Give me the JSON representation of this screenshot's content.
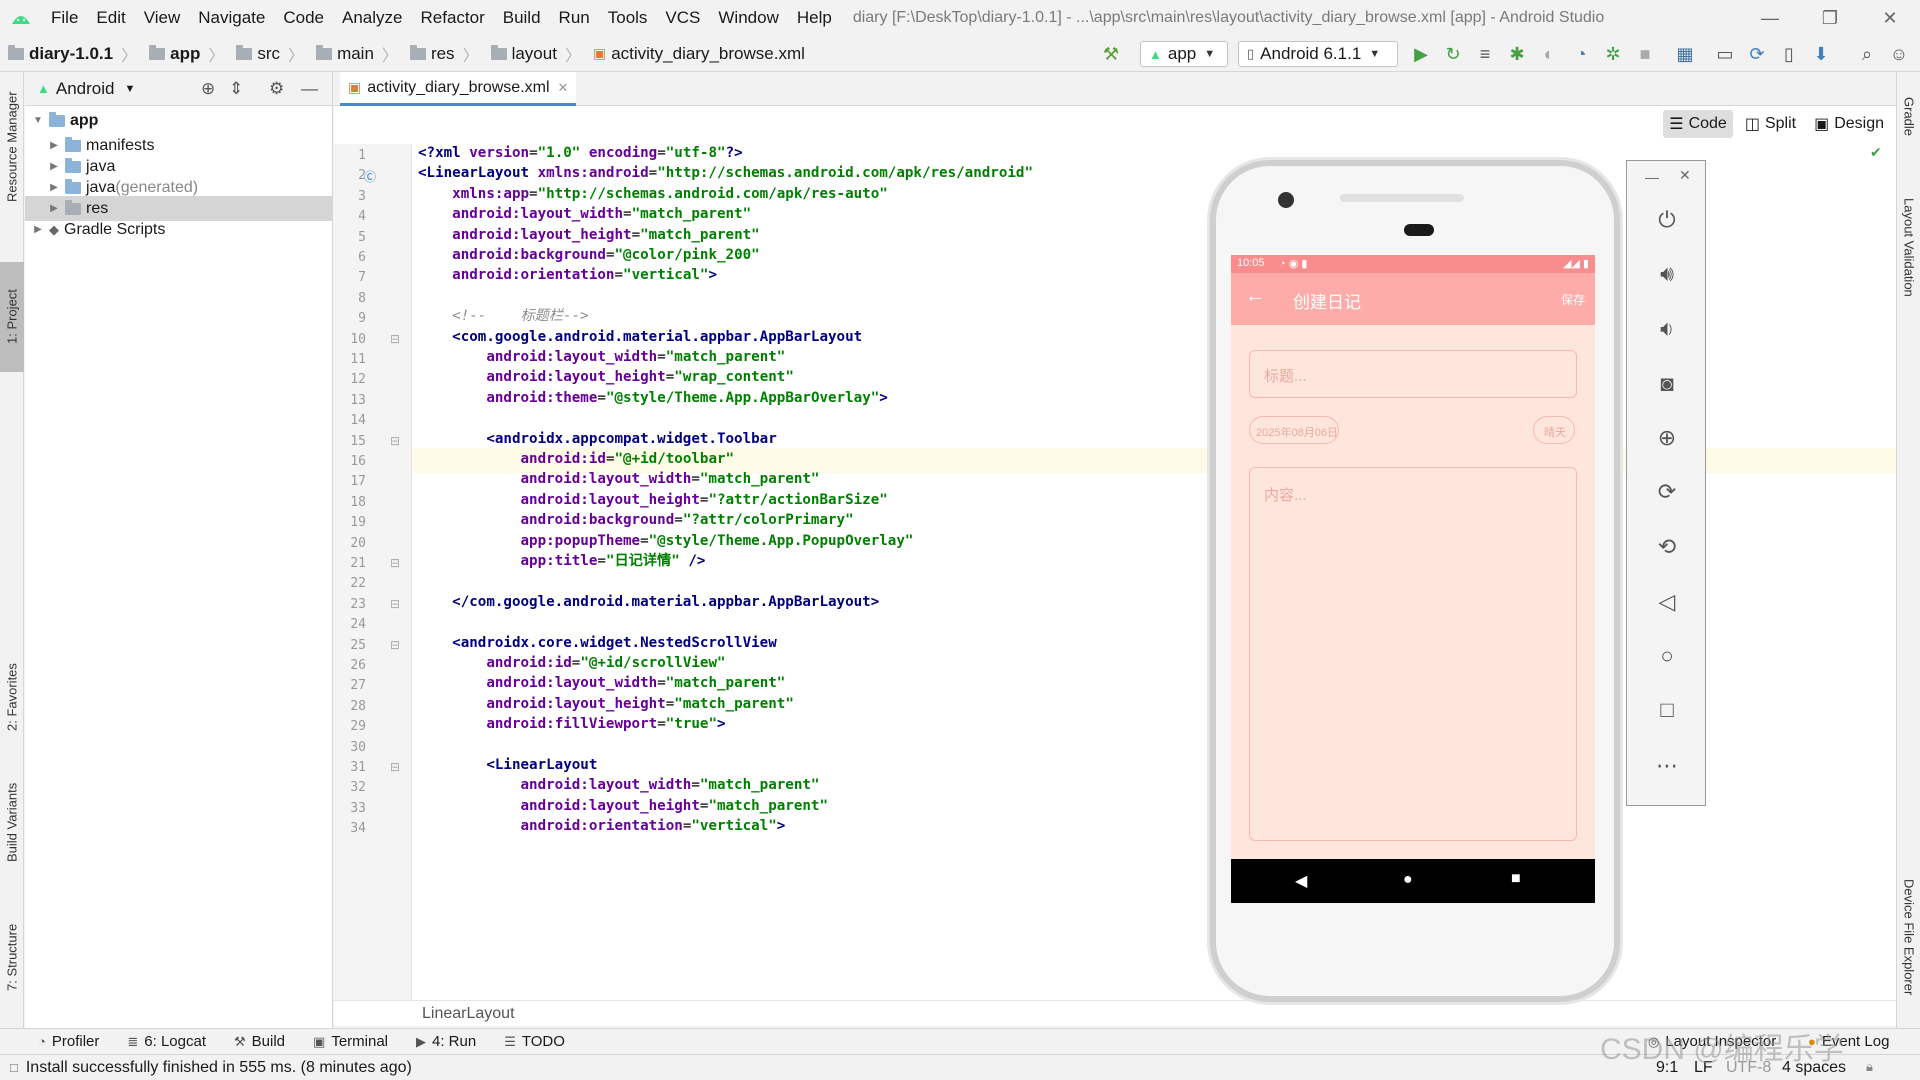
{
  "menubar": {
    "items": [
      "File",
      "Edit",
      "View",
      "Navigate",
      "Code",
      "Analyze",
      "Refactor",
      "Build",
      "Run",
      "Tools",
      "VCS",
      "Window",
      "Help"
    ],
    "window_title": "diary [F:\\DeskTop\\diary-1.0.1] - ...\\app\\src\\main\\res\\layout\\activity_diary_browse.xml [app] - Android Studio"
  },
  "navbar": {
    "crumbs": [
      "diary-1.0.1",
      "app",
      "src",
      "main",
      "res",
      "layout",
      "activity_diary_browse.xml"
    ],
    "run_config": "app",
    "device": "Android 6.1.1"
  },
  "left_stripe": {
    "resource_manager": "Resource Manager",
    "project": "1: Project",
    "favorites": "2: Favorites",
    "build_variants": "Build Variants",
    "structure": "7: Structure"
  },
  "right_stripe": {
    "gradle": "Gradle",
    "layout_validation": "Layout Validation",
    "device_file_explorer": "Device File Explorer"
  },
  "project_panel": {
    "view": "Android",
    "tree": [
      {
        "label": "app",
        "bold": true
      },
      {
        "label": "manifests"
      },
      {
        "label": "java"
      },
      {
        "label": "java",
        "suffix": " (generated)"
      },
      {
        "label": "res"
      },
      {
        "label": "Gradle Scripts"
      }
    ]
  },
  "editor": {
    "tab": "activity_diary_browse.xml",
    "view_modes": [
      "Code",
      "Split",
      "Design"
    ],
    "active_mode": "Code",
    "highlighted_line": 9,
    "line_numbers": [
      "1",
      "2",
      "3",
      "4",
      "5",
      "6",
      "7",
      "8",
      "9",
      "10",
      "11",
      "12",
      "13",
      "14",
      "15",
      "16",
      "17",
      "18",
      "19",
      "20",
      "21",
      "22",
      "23",
      "24",
      "25",
      "26",
      "27",
      "28",
      "29",
      "30",
      "31",
      "32",
      "33",
      "34"
    ],
    "breadcrumb": "LinearLayout"
  },
  "code_lines": [
    "<?xml version=\"1.0\" encoding=\"utf-8\"?>",
    "<LinearLayout xmlns:android=\"http://schemas.android.com/apk/res/android\"",
    "    xmlns:app=\"http://schemas.android.com/apk/res-auto\"",
    "    android:layout_width=\"match_parent\"",
    "    android:layout_height=\"match_parent\"",
    "    android:background=\"@color/pink_200\"",
    "    android:orientation=\"vertical\">",
    "",
    "    <!--    标题栏-->",
    "    <com.google.android.material.appbar.AppBarLayout",
    "        android:layout_width=\"match_parent\"",
    "        android:layout_height=\"wrap_content\"",
    "        android:theme=\"@style/Theme.App.AppBarOverlay\">",
    "",
    "        <androidx.appcompat.widget.Toolbar",
    "            android:id=\"@+id/toolbar\"",
    "            android:layout_width=\"match_parent\"",
    "            android:layout_height=\"?attr/actionBarSize\"",
    "            android:background=\"?attr/colorPrimary\"",
    "            app:popupTheme=\"@style/Theme.App.PopupOverlay\"",
    "            app:title=\"日记详情\" />",
    "",
    "    </com.google.android.material.appbar.AppBarLayout>",
    "",
    "    <androidx.core.widget.NestedScrollView",
    "        android:id=\"@+id/scrollView\"",
    "        android:layout_width=\"match_parent\"",
    "        android:layout_height=\"match_parent\"",
    "        android:fillViewport=\"true\">",
    "",
    "        <LinearLayout",
    "            android:layout_width=\"match_parent\"",
    "            android:layout_height=\"match_parent\"",
    "            android:orientation=\"vertical\">"
  ],
  "phone": {
    "time": "10:05",
    "app_title": "创建日记",
    "save": "保存",
    "title_placeholder": "标题...",
    "date": "2025年08月06日",
    "weather": "晴天",
    "content_placeholder": "内容..."
  },
  "bottom_tools": [
    "Profiler",
    "6: Logcat",
    "Build",
    "Terminal",
    "4: Run",
    "TODO"
  ],
  "bottom_right": {
    "layout_inspector": "Layout Inspector",
    "event_log": "Event Log"
  },
  "status": {
    "message": "Install successfully finished in 555 ms. (8 minutes ago)",
    "position": "9:1",
    "line_sep": "LF",
    "encoding": "UTF-8",
    "indent": "4 spaces",
    "watermark": "CSDN @编程乐学"
  },
  "colors": {
    "accent": "#4a88c7",
    "phone_bg": "#ffe6dc",
    "appbar": "#fdaca9",
    "statusbar": "#f98c8c"
  }
}
